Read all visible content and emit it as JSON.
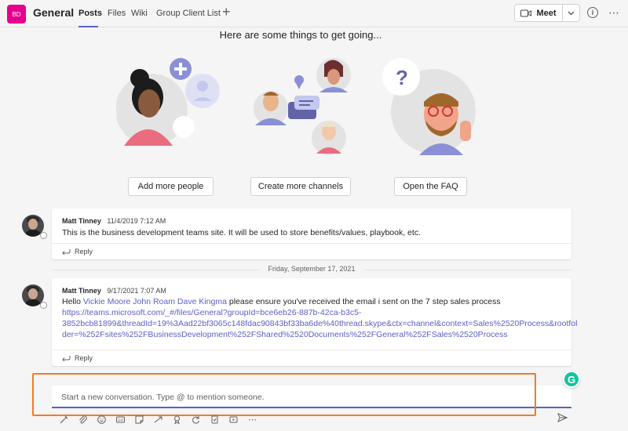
{
  "header": {
    "team_initials": "BD",
    "channel_name": "General",
    "tabs": [
      {
        "label": "Posts",
        "active": true
      },
      {
        "label": "Files",
        "active": false
      },
      {
        "label": "Wiki",
        "active": false
      },
      {
        "label": "Group Client List",
        "active": false
      }
    ],
    "meet_label": "Meet"
  },
  "welcome": {
    "heading": "Here are some things to get going...",
    "actions": [
      {
        "label": "Add more people"
      },
      {
        "label": "Create more channels"
      },
      {
        "label": "Open the FAQ"
      }
    ]
  },
  "messages": [
    {
      "author": "Matt Tinney",
      "timestamp": "11/4/2019 7:12 AM",
      "body": "This is the business development teams site. It will be used to store benefits/values, playbook, etc.",
      "reply_label": "Reply"
    },
    {
      "author": "Matt Tinney",
      "timestamp": "9/17/2021 7:07 AM",
      "greeting": "Hello",
      "mentions": [
        "Vickie Moore",
        "John Roam",
        "Dave Kingma"
      ],
      "body_after_mentions": "please ensure you've received the email i sent on the 7 step sales process",
      "link_lines": [
        "https://teams.microsoft.com/_#/files/General?groupId=bce6eb26-887b-42ca-b3c5-",
        "3852bcb81899&threadId=19%3Aad22bf3065c148fdac90843bf33ba6de%40thread.skype&ctx=channel&context=Sales%2520Process&rootfol",
        "der=%252Fsites%252FBusinessDevelopment%252FShared%2520Documents%252FGeneral%252FSales%2520Process"
      ],
      "reply_label": "Reply"
    }
  ],
  "date_separator": "Friday, September 17, 2021",
  "compose": {
    "placeholder": "Start a new conversation. Type @ to mention someone."
  },
  "colors": {
    "accent": "#5b5fc7",
    "team_avatar": "#e3008c",
    "highlight": "#f07b2a",
    "grammarly": "#15c39a"
  },
  "toolbar_icons": [
    "format-icon",
    "attach-icon",
    "emoji-icon",
    "gif-icon",
    "sticker-icon",
    "meet-now-icon",
    "praise-icon",
    "loop-icon",
    "approvals-icon",
    "stream-icon",
    "more-options-icon"
  ]
}
